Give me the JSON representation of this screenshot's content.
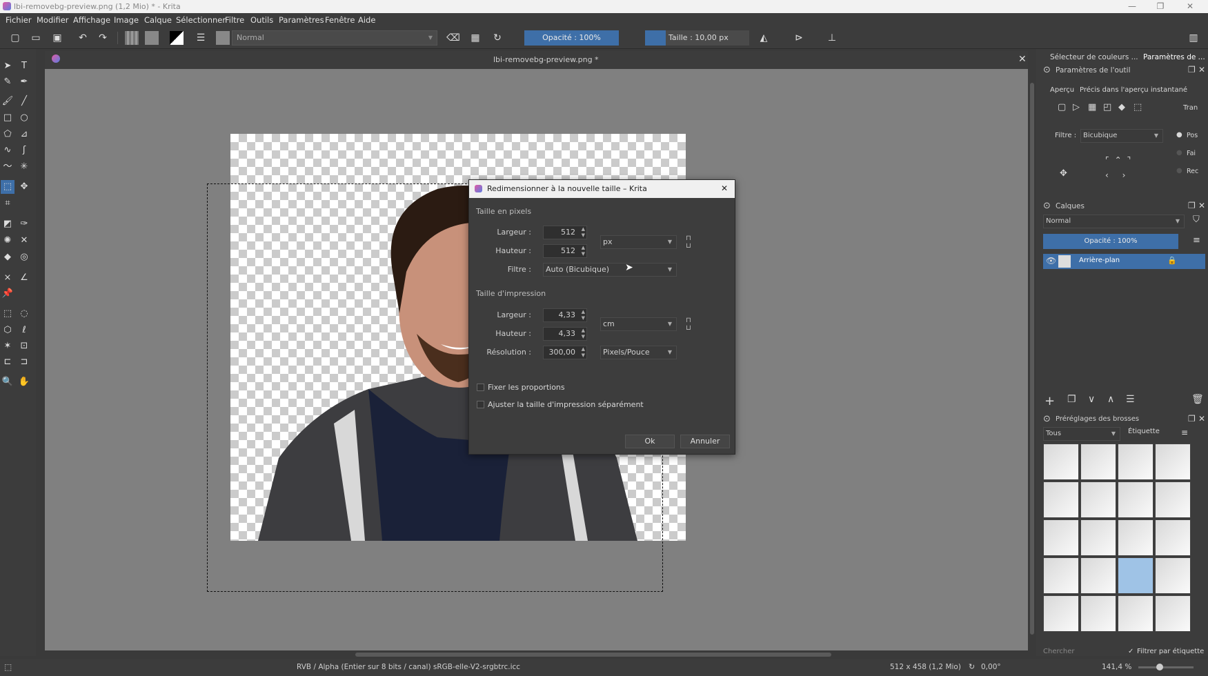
{
  "window": {
    "title": "lbi-removebg-preview.png (1,2 Mio)  * - Krita",
    "minimize": "—",
    "maximize": "❐",
    "close": "✕"
  },
  "menu": [
    "Fichier",
    "Modifier",
    "Affichage",
    "Image",
    "Calque",
    "Sélectionner",
    "Filtre",
    "Outils",
    "Paramètres",
    "Fenêtre",
    "Aide"
  ],
  "toolbar": {
    "blend_mode": "Normal",
    "opacity": "Opacité : 100%",
    "size": "Taille : 10,00 px"
  },
  "document": {
    "tab_title": "lbi-removebg-preview.png *",
    "close": "✕"
  },
  "dialog": {
    "title": "Redimensionner à la nouvelle taille – Krita",
    "close": "✕",
    "pixel_section": "Taille en pixels",
    "width_label": "Largeur :",
    "width_px": "512",
    "height_label": "Hauteur :",
    "height_px": "512",
    "px_unit": "px",
    "filter_label": "Filtre :",
    "filter_value": "Auto (Bicubique)",
    "print_section": "Taille d'impression",
    "print_width_label": "Largeur :",
    "print_width": "4,33",
    "print_height_label": "Hauteur :",
    "print_height": "4,33",
    "print_unit": "cm",
    "resolution_label": "Résolution :",
    "resolution": "300,00",
    "resolution_unit": "Pixels/Pouce",
    "keep_ratio": "Fixer les proportions",
    "adjust_print": "Ajuster la taille d'impression séparément",
    "ok": "Ok",
    "cancel": "Annuler"
  },
  "right": {
    "tabs": [
      "Sélecteur de couleurs ...",
      "Paramètres de ..."
    ],
    "tool_options_title": "Paramètres de l'outil",
    "preview_label": "Aperçu",
    "preview_value": "Précis dans l'aperçu instantané",
    "tran_label": "Tran",
    "filter_label": "Filtre :",
    "filter_value": "Bicubique",
    "radios": [
      "Pos",
      "Fai",
      "Rec"
    ],
    "layers_title": "Calques",
    "layers_blend": "Normal",
    "layers_opacity": "Opacité : 100%",
    "layer_name": "Arrière-plan",
    "brushes_title": "Préréglages des brosses",
    "brushes_filter": "Tous",
    "brushes_tag": "Étiquette",
    "search_placeholder": "Chercher",
    "filter_by_tag": "Filtrer par étiquette"
  },
  "status": {
    "color_info": "RVB / Alpha (Entier sur 8 bits / canal) sRGB-elle-V2-srgbtrc.icc",
    "dimensions": "512 x 458 (1,2 Mio)",
    "rotation": "0,00°",
    "zoom": "141,4 %"
  }
}
